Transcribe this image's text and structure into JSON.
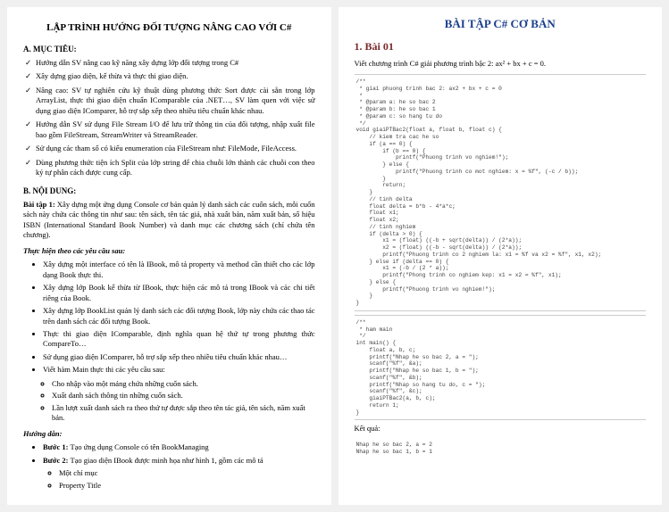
{
  "left": {
    "title": "LẬP TRÌNH HƯỚNG ĐỐI TƯỢNG NÂNG CAO VỚI C#",
    "sec_a": "A. MỤC TIÊU:",
    "goals": [
      "Hướng dẫn SV nâng cao kỹ năng xây dựng lớp đối tượng trong C#",
      "Xây dựng giao diện, kế thừa và thực thi giao diện.",
      "Nâng cao: SV tự nghiên cứu kỹ thuật dùng phương thức Sort được cài sẵn trong lớp ArrayList, thực thi giao diện chuẩn IComparable của .NET…, SV làm quen với việc sử dụng giao diện IComparer, hỗ trợ sắp xếp theo nhiều tiêu chuẩn khác nhau.",
      "Hướng dẫn SV sử dụng File Stream I/O để lưu trữ thông tin của đối tượng, nhập xuất file bao gồm FileStream, StreamWriter và StreamReader.",
      "Sử dụng các tham số có kiểu enumeration của FileStream như: FileMode, FileAccess.",
      "Dùng phương thức tiện ích Split của lớp string để chia chuỗi lớn thành các chuỗi con theo ký tự phân cách được cung cấp."
    ],
    "sec_b": "B. NỘI DUNG:",
    "bt1_label": "Bài tập 1:",
    "bt1_text": "Xây dựng một ứng dụng Console cơ bản quản lý danh sách các cuốn sách, mỗi cuốn sách này chứa các thông tin như sau: tên sách, tên tác giả, nhà xuất bản, năm xuất bản, số hiệu ISBN (International Standard Book Number) và danh mục các chương sách (chỉ chứa tên chương).",
    "steps_label": "Thực hiện theo các yêu cầu sau:",
    "steps": [
      "Xây dựng một interface có tên là IBook, mô tả property và method cần thiết cho các lớp dạng Book thực thi.",
      "Xây dựng lớp Book kế thừa từ IBook, thực hiện các mô tả trong IBook và các chi tiết riêng của Book.",
      "Xây dựng lớp BookList quản lý danh sách các đối tượng Book, lớp này chứa các thao tác trên danh sách các đối tượng Book.",
      "Thực thi giao diện IComparable, định nghĩa quan hệ thứ tự trong phương thức CompareTo…",
      "Sử dụng giao diện IComparer, hỗ trợ sắp xếp theo nhiều tiêu chuẩn khác nhau…",
      "Viết hàm Main thực thi các yêu cầu sau:"
    ],
    "main_steps": [
      "Cho nhập vào một mảng chứa những cuốn sách.",
      "Xuất danh sách thông tin những cuốn sách.",
      "Lần lượt xuất danh sách ra theo thứ tự được sắp theo tên tác giả, tên sách, năm xuất bản."
    ],
    "huongdan": "Hướng dẫn:",
    "b1_label": "Bước 1:",
    "b1_text": "Tạo ứng dụng Console có tên BookManaging",
    "b2_label": "Bước 2:",
    "b2_text": "Tạo giao diện IBook được minh họa như hình 1, gồm các mô tả",
    "b2_items": [
      "Một chỉ mục",
      "Property Title"
    ]
  },
  "right": {
    "header": "BÀI TẬP C# CƠ BẢN",
    "bai": "1. Bài 01",
    "desc": "Viết chương trình C# giải phương trình bậc 2: ax² + bx + c = 0.",
    "code1": "/**\n * giai phuong trinh bac 2: ax2 + bx + c = 0\n *\n * @param a: he so bac 2\n * @param b: he so bac 1\n * @param c: so hang tu do\n */\nvoid giaiPTBac2(float a, float b, float c) {\n    // kiem tra cac he so\n    if (a == 0) {\n        if (b == 0) {\n            printf(\"Phuong trinh vo nghiem!\");\n        } else {\n            printf(\"Phuong trinh co mot nghiem: x = %f\", (-c / b));\n        }\n        return;\n    }\n    // tinh delta\n    float delta = b*b - 4*a*c;\n    float x1;\n    float x2;\n    // tinh nghiem\n    if (delta > 0) {\n        x1 = (float) ((-b + sqrt(delta)) / (2*a));\n        x2 = (float) ((-b - sqrt(delta)) / (2*a));\n        printf(\"Phuong trinh co 2 nghiem la: x1 = %f va x2 = %f\", x1, x2);\n    } else if (delta == 0) {\n        x1 = (-b / (2 * a));\n        printf(\"Phong trinh co nghiem kep: x1 = x2 = %f\", x1);\n    } else {\n        printf(\"Phuong trinh vo nghiem!\");\n    }\n}",
    "code2": "/**\n * ham main\n */\nint main() {\n    float a, b, c;\n    printf(\"Nhap he so bac 2, a = \");\n    scanf(\"%f\", &a);\n    printf(\"Nhap he so bac 1, b = \");\n    scanf(\"%f\", &b);\n    printf(\"Nhap so hang tu do, c = \");\n    scanf(\"%f\", &c);\n    giaiPTBac2(a, b, c);\n    return 1;\n}",
    "kq": "Kết quả:",
    "output": "Nhap he so bac 2, a = 2\nNhap he so bac 1, b = 1"
  }
}
